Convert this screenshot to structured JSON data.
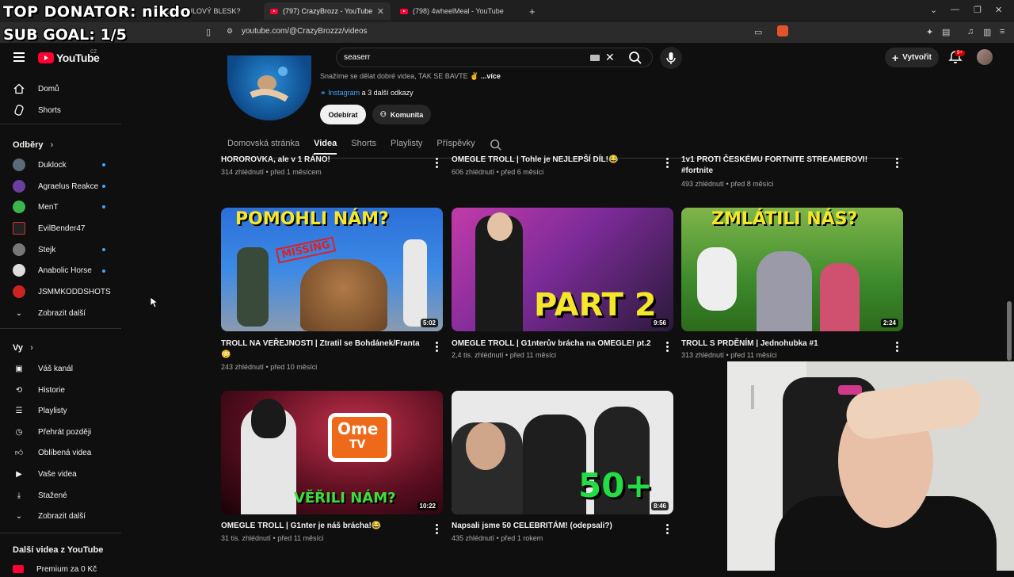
{
  "browser": {
    "tabs": [
      {
        "title": "někdy KULOVÝ BLESK?"
      },
      {
        "title": "(797) CrazyBrozz - YouTube"
      },
      {
        "title": "(798) 4wheelMeal - YouTube"
      }
    ],
    "url": "youtube.com/@CrazyBrozzz/videos"
  },
  "overlay": {
    "line1": "TOP DONATOR: nikdo",
    "line2": "SUB GOAL: 1/5"
  },
  "header": {
    "logo_text": "YouTube",
    "country": "CZ",
    "search_value": "seaserr",
    "create_label": "Vytvořit",
    "notif_badge": "9+"
  },
  "sidebar": {
    "main": [
      {
        "label": "Domů",
        "icon": "home-icon"
      },
      {
        "label": "Shorts",
        "icon": "shorts-icon"
      }
    ],
    "subs_header": "Odběry",
    "subs": [
      {
        "label": "Duklock",
        "color": "#5a6a7a",
        "dot": true
      },
      {
        "label": "Agraelus Reakce",
        "color": "#6b3fa0",
        "dot": true
      },
      {
        "label": "MenT",
        "color": "#3ab54a",
        "dot": true
      },
      {
        "label": "EvilBender47",
        "color": "#222222",
        "dot": false
      },
      {
        "label": "Stejk",
        "color": "#777777",
        "dot": true
      },
      {
        "label": "Anabolic Horse",
        "color": "#dddddd",
        "dot": true
      },
      {
        "label": "JSMMKODDSHOTS",
        "color": "#cc2222",
        "dot": false
      }
    ],
    "subs_more": "Zobrazit další",
    "you_header": "Vy",
    "you": [
      {
        "label": "Váš kanál",
        "icon": "channel-icon"
      },
      {
        "label": "Historie",
        "icon": "history-icon"
      },
      {
        "label": "Playlisty",
        "icon": "playlist-icon"
      },
      {
        "label": "Přehrát později",
        "icon": "clock-icon"
      },
      {
        "label": "Oblíbená videa",
        "icon": "like-icon"
      },
      {
        "label": "Vaše videa",
        "icon": "video-icon"
      },
      {
        "label": "Stažené",
        "icon": "download-icon"
      }
    ],
    "you_more": "Zobrazit další",
    "more_header": "Další videa z YouTube",
    "premium": "Premium za 0 Kč"
  },
  "channel": {
    "description": "Snažíme se dělat dobré videa, TAK SE BAVTE ✌",
    "more": "...více",
    "link_label": "Instagram",
    "link_rest": "a 3 další odkazy",
    "subscribe": "Odebírat",
    "community": "Komunita",
    "tabs": [
      "Domovská stránka",
      "Videa",
      "Shorts",
      "Playlisty",
      "Příspěvky"
    ]
  },
  "videos_top": [
    {
      "title": "HOROROVKA, ale v 1 RÁNO!",
      "meta": "314 zhlédnutí • před 1 měsícem"
    },
    {
      "title": "OMEGLE TROLL | Tohle je NEJLEPŠÍ DÍL!😂",
      "meta": "606 zhlédnutí • před 6 měsíci"
    },
    {
      "title": "1v1 PROTI ČESKÉMU FORTNITE STREAMEROVI! #fortnite",
      "meta": "493 zhlédnutí • před 8 měsíci"
    }
  ],
  "videos_mid": [
    {
      "title": "TROLL NA VEŘEJNOSTI | Ztratil se Bohdánek/Franta 😳",
      "meta": "243 zhlédnutí • před 10 měsíci",
      "duration": "5:02",
      "thumb_text": "POMOHLI NÁM?",
      "thumb_sub": "MISSING"
    },
    {
      "title": "OMEGLE TROLL | G1nterův brácha na OMEGLE! pt.2",
      "meta": "2,4 tis. zhlédnutí • před 11 měsíci",
      "duration": "9:56",
      "thumb_text": "PART 2"
    },
    {
      "title": "TROLL S PRDĚNÍM | Jednohubka #1",
      "meta": "313 zhlédnutí • před 11 měsíci",
      "duration": "2:24",
      "thumb_text": "ZMLÁTILI NÁS?"
    }
  ],
  "videos_bot": [
    {
      "title": "OMEGLE TROLL | G1nter je náš brácha!😂",
      "meta": "31 tis. zhlédnutí • před 11 měsíci",
      "duration": "10:22",
      "thumb_text": "VĚŘILI NÁM?",
      "thumb_logo1": "Ome",
      "thumb_logo2": "TV"
    },
    {
      "title": "Napsali jsme 50 CELEBRITÁM! (odepsali?)",
      "meta": "435 zhlédnutí • před 1 rokem",
      "duration": "8:46",
      "thumb_text": "50+"
    }
  ]
}
